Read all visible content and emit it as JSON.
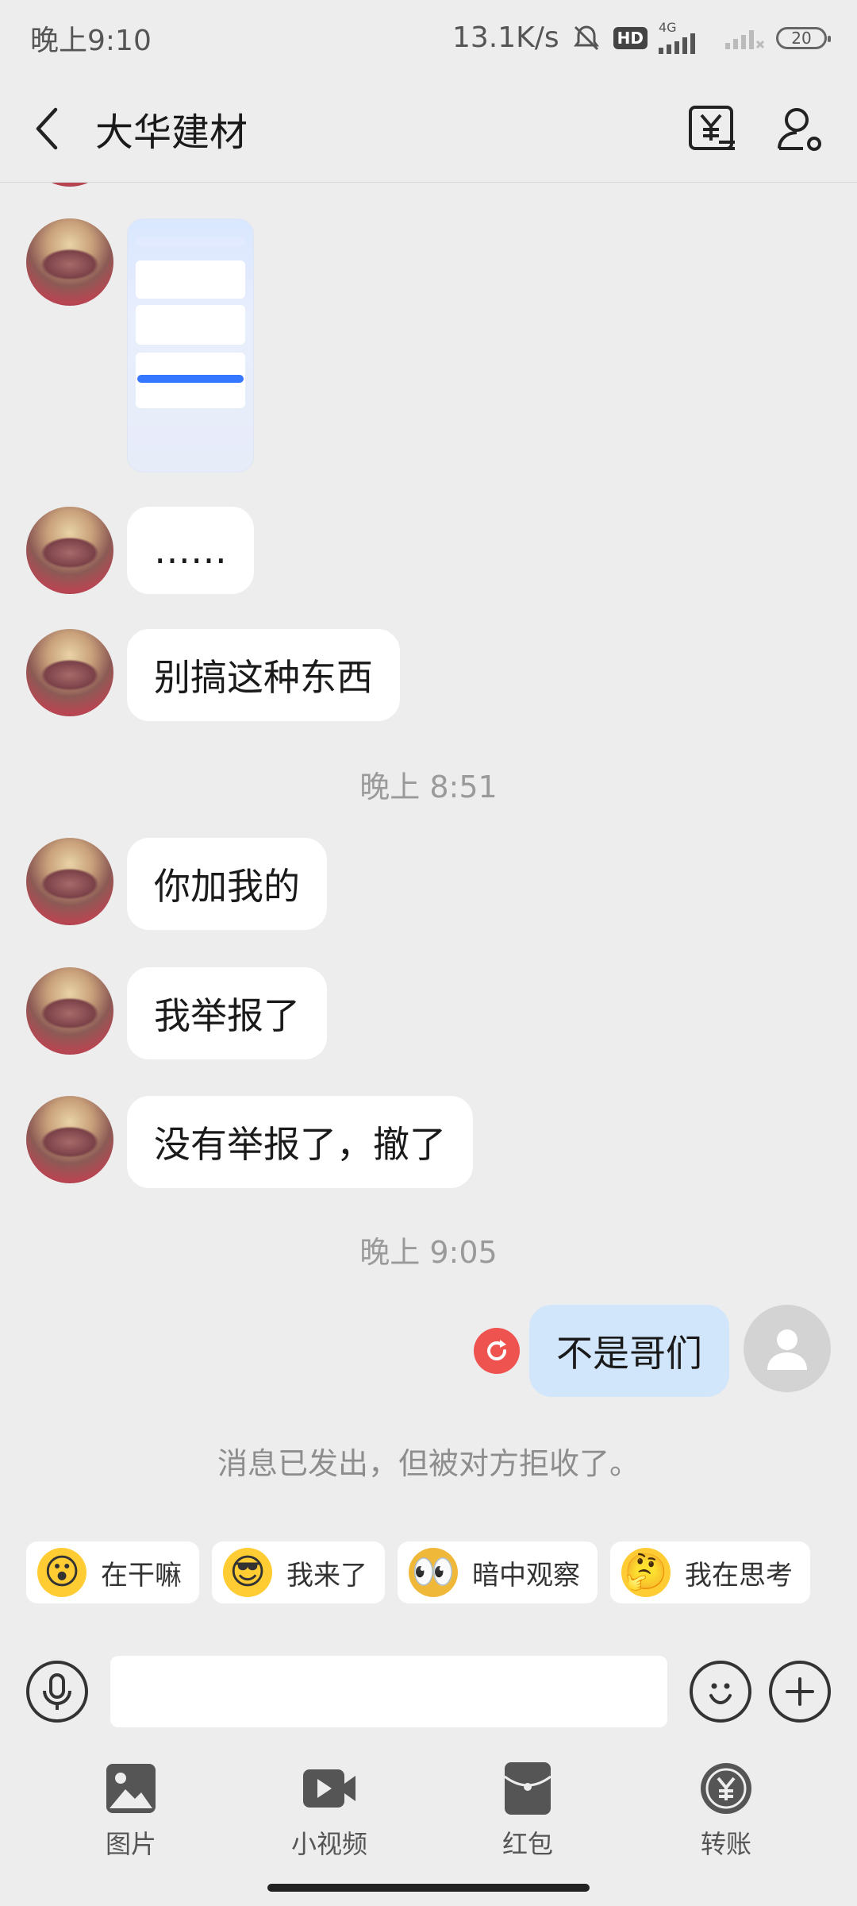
{
  "status_bar": {
    "time": "晚上9:10",
    "network_speed": "13.1K/s",
    "hd": "HD",
    "net_type": "4G",
    "battery": "20"
  },
  "header": {
    "title": "大华建材"
  },
  "messages": [
    {
      "type": "image",
      "from": "other"
    },
    {
      "type": "text",
      "from": "other",
      "text": "……"
    },
    {
      "type": "text",
      "from": "other",
      "text": "别搞这种东西"
    },
    {
      "type": "time",
      "text": "晚上 8:51"
    },
    {
      "type": "text",
      "from": "other",
      "text": "你加我的"
    },
    {
      "type": "text",
      "from": "other",
      "text": "我举报了"
    },
    {
      "type": "text",
      "from": "other",
      "text": "没有举报了，撤了"
    },
    {
      "type": "time",
      "text": "晚上 9:05"
    },
    {
      "type": "text",
      "from": "self",
      "text": "不是哥们",
      "status": "rejected"
    },
    {
      "type": "system",
      "text": "消息已发出，但被对方拒收了。"
    }
  ],
  "quick_stickers": [
    {
      "label": "在干嘛",
      "icon": "emoji-surprised-icon"
    },
    {
      "label": "我来了",
      "icon": "emoji-sunglasses-icon"
    },
    {
      "label": "暗中观察",
      "icon": "emoji-binoculars-icon"
    },
    {
      "label": "我在思考",
      "icon": "emoji-thinking-icon"
    }
  ],
  "input": {
    "placeholder": ""
  },
  "toolbar": [
    {
      "label": "图片",
      "icon": "image-icon"
    },
    {
      "label": "小视频",
      "icon": "video-icon"
    },
    {
      "label": "红包",
      "icon": "red-packet-icon"
    },
    {
      "label": "转账",
      "icon": "transfer-icon"
    }
  ],
  "colors": {
    "background": "#ededed",
    "bubble_in": "#ffffff",
    "bubble_out": "#d2e6fb",
    "resend": "#ef5350"
  }
}
